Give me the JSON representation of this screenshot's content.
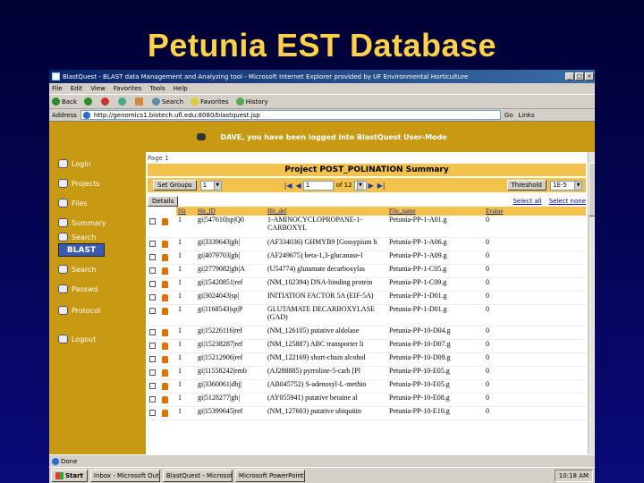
{
  "slide": {
    "title": "Petunia EST Database"
  },
  "window": {
    "title": "BlastQuest - BLAST data Management and Analyzing tool - Microsoft Internet Explorer provided by UF Environmental Horticulture",
    "controls": [
      "_",
      "□",
      "×"
    ]
  },
  "menu": [
    "File",
    "Edit",
    "View",
    "Favorites",
    "Tools",
    "Help"
  ],
  "toolbar": {
    "back": "Back",
    "search": "Search",
    "favorites": "Favorites",
    "history": "History"
  },
  "address": {
    "label": "Address",
    "url": "http://genomics1.biotech.ufl.edu:8080/blastquest.jsp",
    "go": "Go",
    "links": "Links"
  },
  "banner": {
    "text": "DAVE, you have been logged into BlastQuest User-Mode"
  },
  "sidebar": {
    "items": [
      {
        "label": "Login",
        "icon": "login-icon"
      },
      {
        "label": "Projects",
        "icon": "projects-icon"
      },
      {
        "label": "Files",
        "icon": "files-icon"
      },
      {
        "label": "Summary",
        "icon": "summary-icon"
      },
      {
        "label": "Search",
        "icon": "search-icon"
      },
      {
        "label": "Passwd",
        "icon": "password-icon"
      },
      {
        "label": "Protocol",
        "icon": "protocol-icon"
      },
      {
        "label": "Logout",
        "icon": "logout-icon"
      }
    ],
    "blast_logo": "BLAST"
  },
  "main": {
    "page_label": "Page 1",
    "summary_title": "Project POST_POLINATION Summary",
    "controls": {
      "group_button": "Set Groups",
      "group_value": "1",
      "page_value": "1",
      "page_of": "of 12",
      "threshold_button": "Threshold",
      "threshold_value": "1E-5"
    },
    "details_button": "Details",
    "links": [
      "Select all",
      "Select none"
    ],
    "columns": [
      "Hit",
      "Hit_ID",
      "Hit_def",
      "File_name",
      "Evalue"
    ],
    "rows": [
      {
        "hit": "1",
        "hit_id": "gi|547610|sp|Q0",
        "hit_def": "1-AMINOCYCLOPROPANE-1-",
        "file": "Petunia-PP-1-A01.g",
        "evalue": "0",
        "hit_def2": "CARBOXYL"
      },
      {
        "hit": "1",
        "hit_id": "gi|3339643|gb|",
        "hit_def": "(AF334036) GHMYB9 [Gossypium h",
        "file": "Petunia-PP-1-A06.g",
        "evalue": "0"
      },
      {
        "hit": "1",
        "hit_id": "gi|4079703|gb|",
        "hit_def": "(AF249675) beta-1,3-glucanase-l",
        "file": "Petunia-PP-1-A09.g",
        "evalue": "0"
      },
      {
        "hit": "1",
        "hit_id": "gi|2779082|gb|A",
        "hit_def": "(U54774) glutamate decarboxylas",
        "file": "Petunia-PP-1-C05.g",
        "evalue": "0"
      },
      {
        "hit": "1",
        "hit_id": "gi|15420851|ref",
        "hit_def": "(NM_102394) DNA-binding protein",
        "file": "Petunia-PP-1-C09.g",
        "evalue": "0"
      },
      {
        "hit": "1",
        "hit_id": "gi|3024043|sp|",
        "hit_def": "INITIATION FACTOR 5A (EIF-5A)",
        "file": "Petunia-PP-1-D01.g",
        "evalue": "0"
      },
      {
        "hit": "1",
        "hit_id": "gi|1168543|sp|P",
        "hit_def": "GLUTAMATE DECARBOXYLASE",
        "file": "Petunia-PP-1-D01.g",
        "evalue": "0",
        "hit_def2": "(GAD)"
      },
      {
        "hit": "1",
        "hit_id": "gi|15226116|ref",
        "hit_def": "(NM_126105) putative aldolase",
        "file": "Petunia-PP-10-D04.g",
        "evalue": "0"
      },
      {
        "hit": "1",
        "hit_id": "gi|15238287|ref",
        "hit_def": "(NM_125887) ABC transporter li",
        "file": "Petunia-PP-10-D07.g",
        "evalue": "0"
      },
      {
        "hit": "1",
        "hit_id": "gi|15212906|ref",
        "hit_def": "(NM_122169) short-chain alcohol",
        "file": "Petunia-PP-10-D09.g",
        "evalue": "0"
      },
      {
        "hit": "1",
        "hit_id": "gi|11558242|emb",
        "hit_def": "(AJ288885) pyrroline-5-carb [Pl",
        "file": "Petunia-PP-10-E05.g",
        "evalue": "0"
      },
      {
        "hit": "1",
        "hit_id": "gi|3360061|dbj|",
        "hit_def": "(AB045752) S-adenosyl-L-methio",
        "file": "Petunia-PP-10-E05.g",
        "evalue": "0"
      },
      {
        "hit": "1",
        "hit_id": "gi|5128277|gb|",
        "hit_def": "(AY055941) putative betaine al",
        "file": "Petunia-PP-10-E08.g",
        "evalue": "0"
      },
      {
        "hit": "1",
        "hit_id": "gi|15399645|ref",
        "hit_def": "(NM_127603) putative ubiquitin",
        "file": "Petunia-PP-10-E10.g",
        "evalue": "0"
      }
    ]
  },
  "status": {
    "text": "Done"
  },
  "taskbar": {
    "start": "Start",
    "tasks": [
      "Inbox - Microsoft Outlook",
      "BlastQuest - Microsoft",
      "Microsoft PowerPoint"
    ],
    "clock": "10:18 AM"
  }
}
